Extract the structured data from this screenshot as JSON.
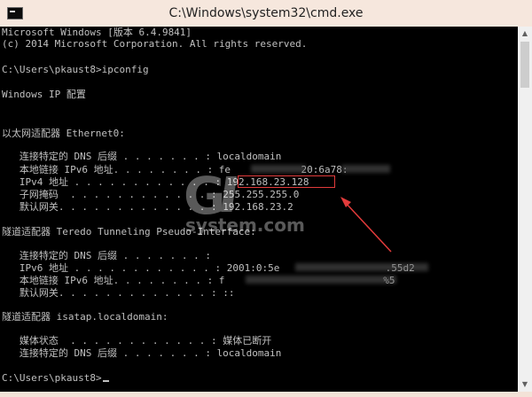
{
  "window": {
    "title": "C:\\Windows\\system32\\cmd.exe"
  },
  "console": {
    "lines": [
      "Microsoft Windows [版本 6.4.9841]",
      "(c) 2014 Microsoft Corporation. All rights reserved.",
      "",
      "C:\\Users\\pkaust8>ipconfig",
      "",
      "Windows IP 配置",
      "",
      "",
      "以太网适配器 Ethernet0:",
      "",
      "   连接特定的 DNS 后缀 . . . . . . . : localdomain",
      "   本地链接 IPv6 地址. . . . . . . . : fe            20:6a78:",
      "   IPv4 地址 . . . . . . . . . . . . : 192.168.23.128",
      "   子网掩码  . . . . . . . . . . . . : 255.255.255.0",
      "   默认网关. . . . . . . . . . . . . : 192.168.23.2",
      "",
      "隧道适配器 Teredo Tunneling Pseudo-Interface:",
      "",
      "   连接特定的 DNS 后缀 . . . . . . . :",
      "   IPv6 地址 . . . . . . . . . . . . : 2001:0:5e                  .55d2",
      "   本地链接 IPv6 地址. . . . . . . . : f                           %5",
      "   默认网关. . . . . . . . . . . . . : ::",
      "",
      "隧道适配器 isatap.localdomain:",
      "",
      "   媒体状态  . . . . . . . . . . . . : 媒体已断开",
      "   连接特定的 DNS 后缀 . . . . . . . : localdomain",
      "",
      "C:\\Users\\pkaust8>"
    ]
  },
  "watermark": {
    "logo": "G",
    "text": "system.com"
  },
  "colors": {
    "console_bg": "#000000",
    "console_text": "#c0c0c0",
    "highlight": "#e23b3b"
  }
}
